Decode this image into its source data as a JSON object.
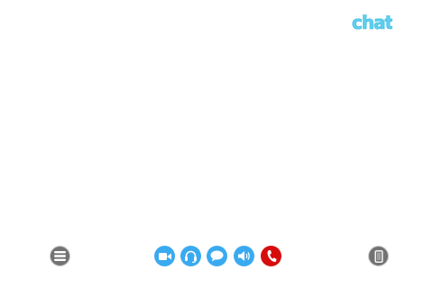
{
  "app": {
    "logo_text": "chat.",
    "logo_color": "#5fd0ee"
  },
  "controls": {
    "menu": {
      "icon": "hamburger-menu-icon"
    },
    "device": {
      "icon": "phone-device-icon"
    },
    "call_bar": [
      {
        "id": "video",
        "icon": "video-camera-icon",
        "color": "#3aaaf0"
      },
      {
        "id": "headset",
        "icon": "headset-icon",
        "color": "#3aaaf0"
      },
      {
        "id": "chat",
        "icon": "chat-bubble-icon",
        "color": "#3aaaf0"
      },
      {
        "id": "volume",
        "icon": "speaker-volume-icon",
        "color": "#3aaaf0"
      },
      {
        "id": "hangup",
        "icon": "phone-handset-icon",
        "color": "#d70d0d"
      }
    ]
  }
}
